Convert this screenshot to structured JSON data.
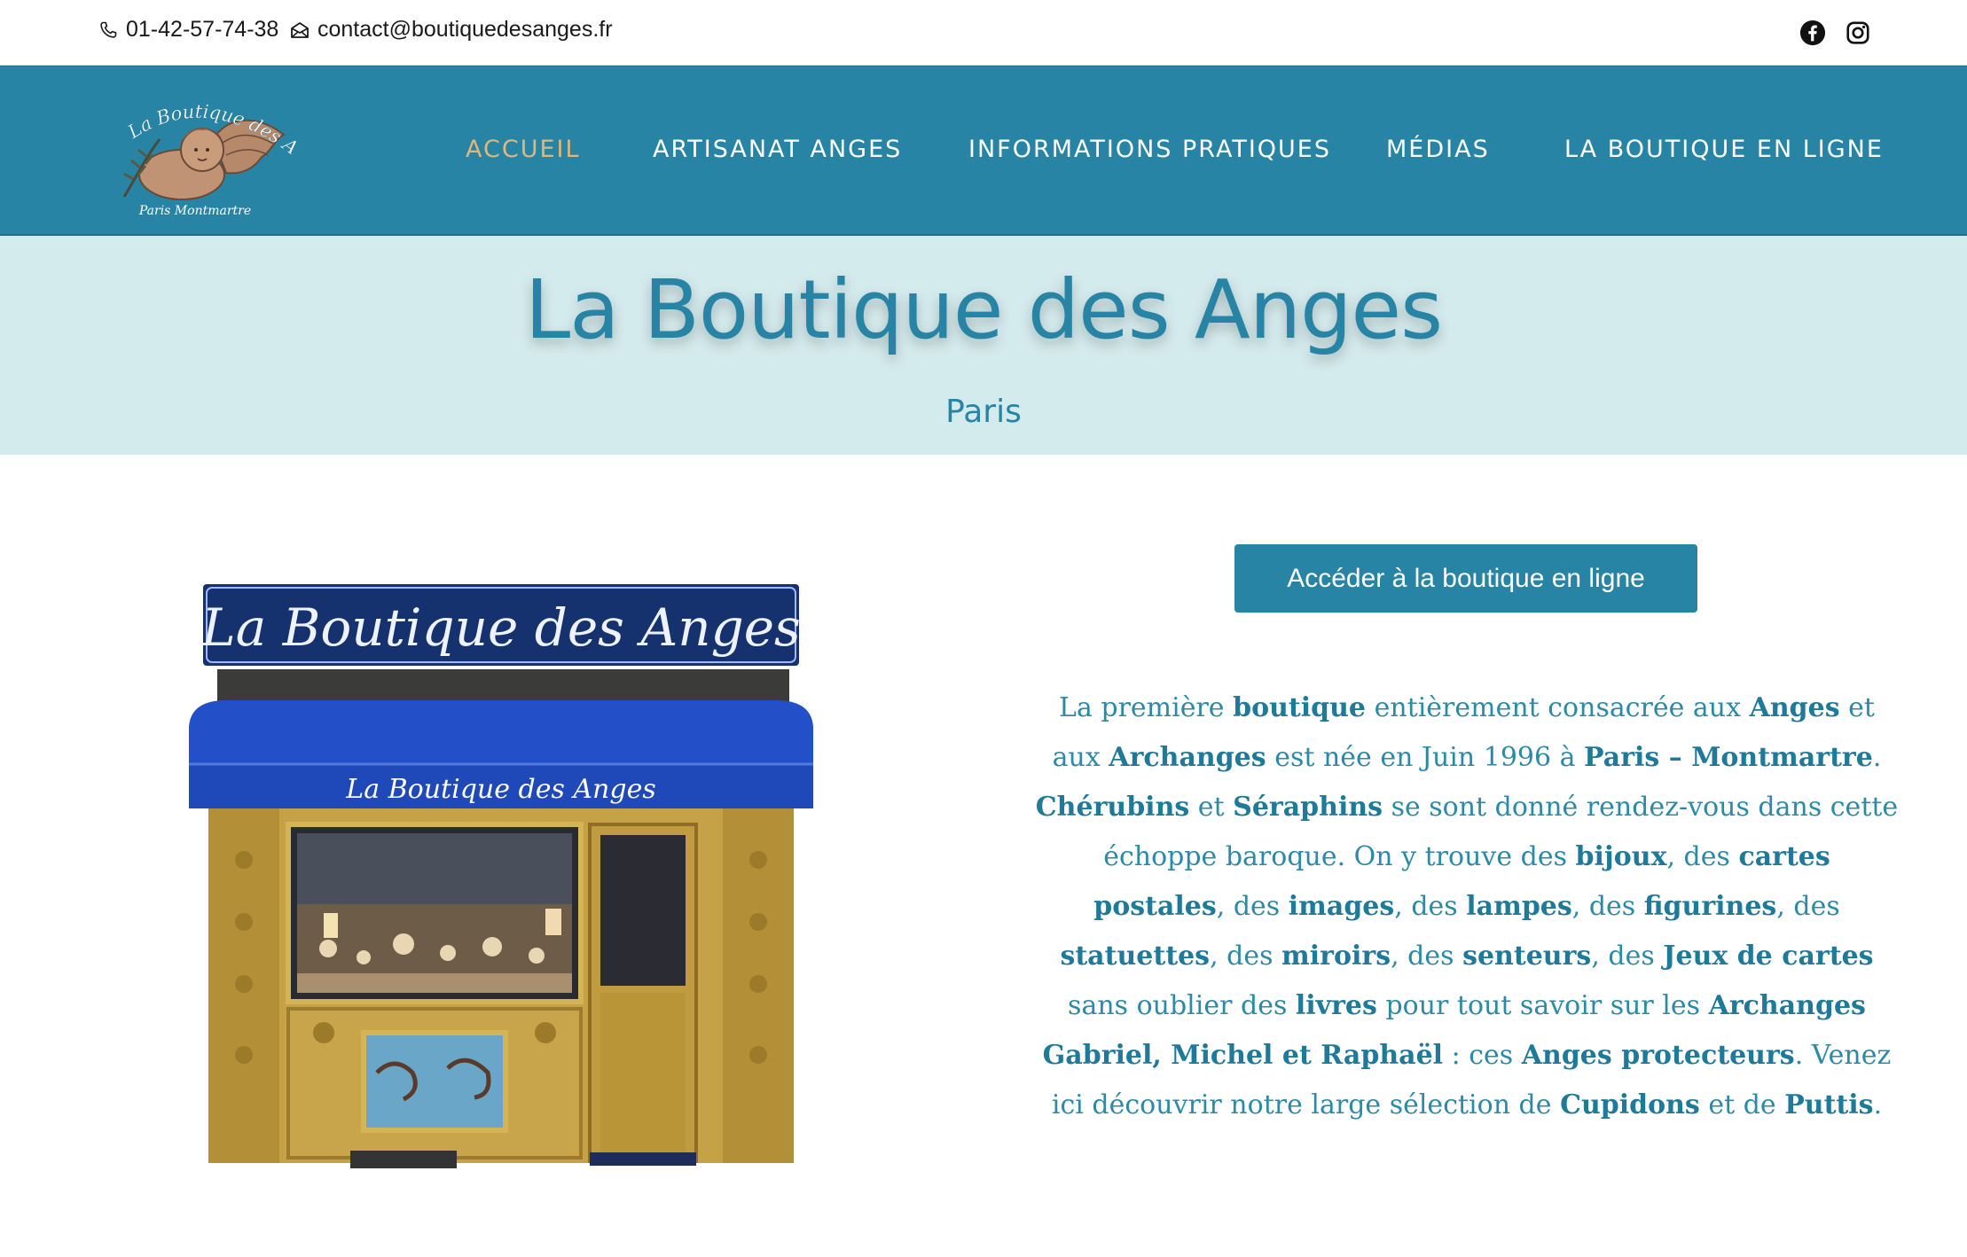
{
  "topbar": {
    "phone": "01-42-57-74-38",
    "email": "contact@boutiquedesanges.fr",
    "social": [
      "facebook-icon",
      "instagram-icon"
    ]
  },
  "logo": {
    "line1": "La Boutique des Anges",
    "line2": "Paris Montmartre"
  },
  "nav": {
    "items": [
      {
        "label": "ACCUEIL",
        "active": true
      },
      {
        "label": "ARTISANAT ANGES"
      },
      {
        "label": "INFORMATIONS PRATIQUES"
      },
      {
        "label": "MÉDIAS"
      },
      {
        "label": "LA BOUTIQUE EN LIGNE"
      }
    ]
  },
  "hero": {
    "title": "La Boutique des Anges",
    "subtitle": "Paris"
  },
  "shop_image": {
    "sign": "La Boutique des Anges",
    "awning": "La Boutique des Anges"
  },
  "cta": {
    "label": "Accéder à la boutique en ligne"
  },
  "description": [
    {
      "t": "La première "
    },
    {
      "b": "boutique"
    },
    {
      "t": " entièrement consacrée aux "
    },
    {
      "b": "Anges"
    },
    {
      "t": " et aux "
    },
    {
      "b": "Archanges"
    },
    {
      "t": " est née en Juin 1996 à "
    },
    {
      "b": "Paris – Montmartre"
    },
    {
      "t": ". "
    },
    {
      "b": "Chérubins"
    },
    {
      "t": " et "
    },
    {
      "b": "Séraphins"
    },
    {
      "t": " se sont donné rendez-vous dans cette échoppe baroque. On y trouve des "
    },
    {
      "b": "bijoux"
    },
    {
      "t": ", des "
    },
    {
      "b": "cartes postales"
    },
    {
      "t": ", des "
    },
    {
      "b": "images"
    },
    {
      "t": ", des "
    },
    {
      "b": "lampes"
    },
    {
      "t": ", des "
    },
    {
      "b": "figurines"
    },
    {
      "t": ", des "
    },
    {
      "b": "statuettes"
    },
    {
      "t": ", des "
    },
    {
      "b": "miroirs"
    },
    {
      "t": ", des "
    },
    {
      "b": "senteurs"
    },
    {
      "t": ", des "
    },
    {
      "b": "Jeux de cartes"
    },
    {
      "t": " sans oublier des "
    },
    {
      "b": "livres"
    },
    {
      "t": " pour tout savoir sur les "
    },
    {
      "b": "Archanges Gabriel, Michel et Raphaël"
    },
    {
      "t": " : ces "
    },
    {
      "b": "Anges protecteurs"
    },
    {
      "t": ". Venez ici découvrir notre large sélection de "
    },
    {
      "b": "Cupidons"
    },
    {
      "t": " et de "
    },
    {
      "b": "Puttis"
    },
    {
      "t": "."
    }
  ]
}
